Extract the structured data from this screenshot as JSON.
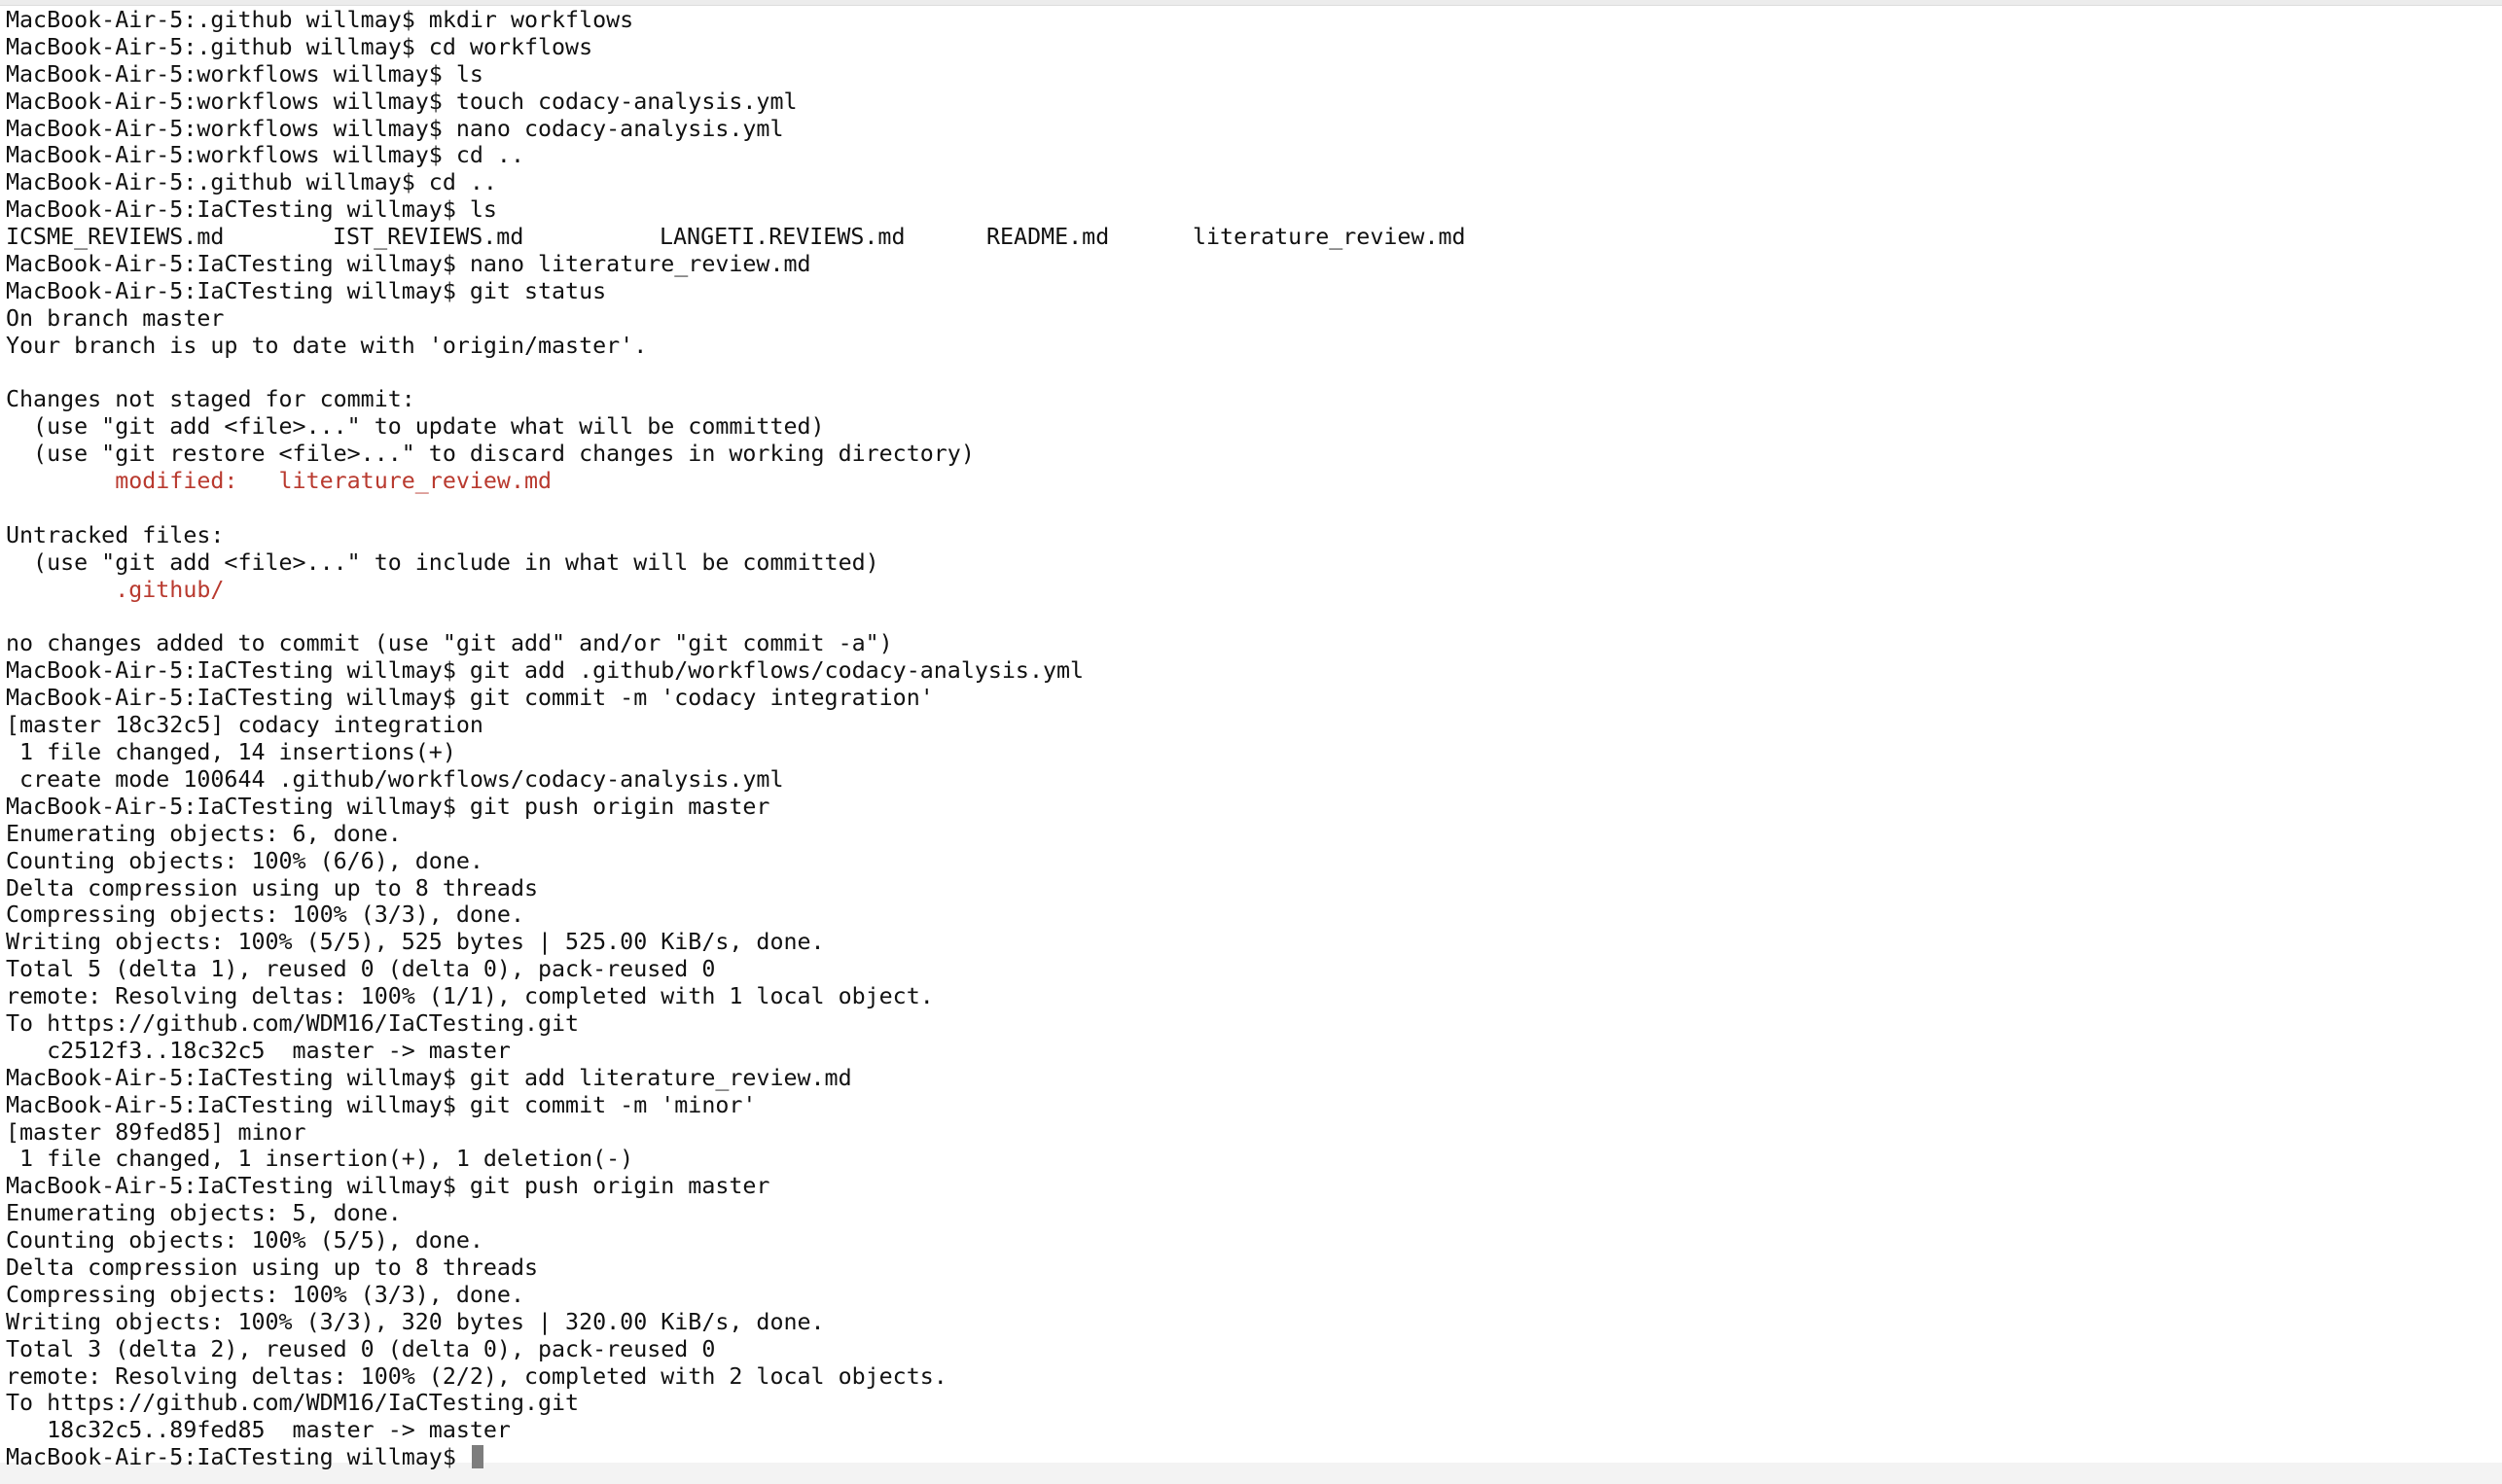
{
  "terminal": {
    "prompt": {
      "github": "MacBook-Air-5:.github willmay$ ",
      "workflows": "MacBook-Air-5:workflows willmay$ ",
      "iac": "MacBook-Air-5:IaCTesting willmay$ "
    },
    "lines": [
      "MacBook-Air-5:.github willmay$ mkdir workflows",
      "MacBook-Air-5:.github willmay$ cd workflows",
      "MacBook-Air-5:workflows willmay$ ls",
      "MacBook-Air-5:workflows willmay$ touch codacy-analysis.yml",
      "MacBook-Air-5:workflows willmay$ nano codacy-analysis.yml",
      "MacBook-Air-5:workflows willmay$ cd ..",
      "MacBook-Air-5:.github willmay$ cd ..",
      "MacBook-Air-5:IaCTesting willmay$ ls"
    ],
    "ls_files": [
      "ICSME_REVIEWS.md",
      "IST_REVIEWS.md",
      "LANGETI.REVIEWS.md",
      "README.md",
      "literature_review.md"
    ],
    "status_lines": [
      "MacBook-Air-5:IaCTesting willmay$ nano literature_review.md",
      "MacBook-Air-5:IaCTesting willmay$ git status",
      "On branch master",
      "Your branch is up to date with 'origin/master'.",
      "",
      "Changes not staged for commit:",
      "  (use \"git add <file>...\" to update what will be committed)",
      "  (use \"git restore <file>...\" to discard changes in working directory)"
    ],
    "modified_line": "        modified:   literature_review.md",
    "untracked_lines": [
      "",
      "Untracked files:",
      "  (use \"git add <file>...\" to include in what will be committed)"
    ],
    "untracked_file": "        .github/",
    "rest_lines": [
      "",
      "no changes added to commit (use \"git add\" and/or \"git commit -a\")",
      "MacBook-Air-5:IaCTesting willmay$ git add .github/workflows/codacy-analysis.yml",
      "MacBook-Air-5:IaCTesting willmay$ git commit -m 'codacy integration'",
      "[master 18c32c5] codacy integration",
      " 1 file changed, 14 insertions(+)",
      " create mode 100644 .github/workflows/codacy-analysis.yml",
      "MacBook-Air-5:IaCTesting willmay$ git push origin master",
      "Enumerating objects: 6, done.",
      "Counting objects: 100% (6/6), done.",
      "Delta compression using up to 8 threads",
      "Compressing objects: 100% (3/3), done.",
      "Writing objects: 100% (5/5), 525 bytes | 525.00 KiB/s, done.",
      "Total 5 (delta 1), reused 0 (delta 0), pack-reused 0",
      "remote: Resolving deltas: 100% (1/1), completed with 1 local object.",
      "To https://github.com/WDM16/IaCTesting.git",
      "   c2512f3..18c32c5  master -> master",
      "MacBook-Air-5:IaCTesting willmay$ git add literature_review.md",
      "MacBook-Air-5:IaCTesting willmay$ git commit -m 'minor'",
      "[master 89fed85] minor",
      " 1 file changed, 1 insertion(+), 1 deletion(-)",
      "MacBook-Air-5:IaCTesting willmay$ git push origin master",
      "Enumerating objects: 5, done.",
      "Counting objects: 100% (5/5), done.",
      "Delta compression using up to 8 threads",
      "Compressing objects: 100% (3/3), done.",
      "Writing objects: 100% (3/3), 320 bytes | 320.00 KiB/s, done.",
      "Total 3 (delta 2), reused 0 (delta 0), pack-reused 0",
      "remote: Resolving deltas: 100% (2/2), completed with 2 local objects.",
      "To https://github.com/WDM16/IaCTesting.git",
      "   18c32c5..89fed85  master -> master"
    ],
    "final_prompt": "MacBook-Air-5:IaCTesting willmay$ ",
    "colors": {
      "background": "#ffffff",
      "text": "#111111",
      "git_status_red": "#b93a2f",
      "cursor": "#7d7d7d"
    }
  }
}
